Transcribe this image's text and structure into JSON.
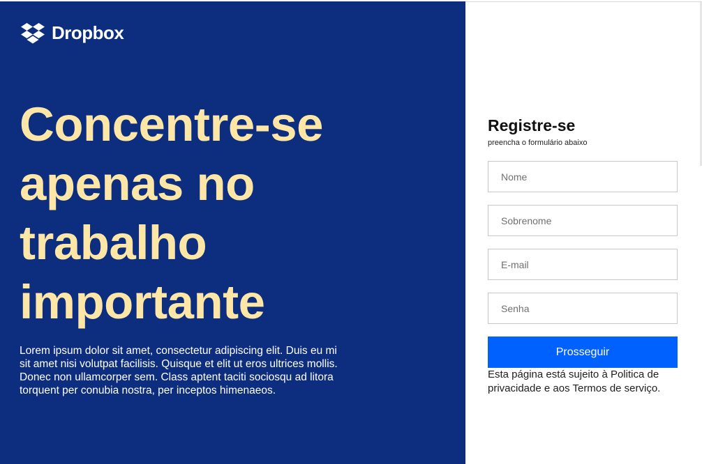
{
  "brand": {
    "name": "Dropbox",
    "icon": "dropbox-icon"
  },
  "hero": {
    "headline_lines": [
      "Concentre-se",
      "apenas no",
      "trabalho",
      "importante"
    ],
    "body": "Lorem ipsum dolor sit amet, consectetur adipiscing elit. Duis eu mi sit amet nisi volutpat facilisis. Quisque et elit ut eros ultrices mollis. Donec non ullamcorper sem. Class aptent taciti sociosqu ad litora torquent per conubia nostra, per inceptos himenaeos."
  },
  "form": {
    "title": "Registre-se",
    "subtitle": "preencha o formulário abaixo",
    "fields": {
      "first_name": {
        "placeholder": "Nome",
        "value": ""
      },
      "last_name": {
        "placeholder": "Sobrenome",
        "value": ""
      },
      "email": {
        "placeholder": "E-mail",
        "value": ""
      },
      "password": {
        "placeholder": "Senha",
        "value": ""
      }
    },
    "submit_label": "Prosseguir",
    "legal": "Esta página está sujeito à Politica de privacidade e aos Termos de serviço."
  },
  "colors": {
    "hero_background": "#0d2e7f",
    "headline": "#fde6a6",
    "accent_button": "#0061fe"
  }
}
